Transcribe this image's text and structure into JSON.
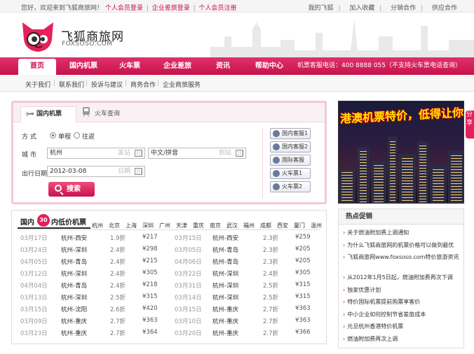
{
  "topbar": {
    "welcome": "您好，欢迎来到飞狐商旅网！",
    "member_login": "个人会员登录",
    "corp_login": "企业差旅登录",
    "register": "个人会员注册",
    "sep": "|",
    "right": [
      "我的飞狐",
      "加入收藏",
      "分销合作",
      "供应合作"
    ],
    "right_sep": "|"
  },
  "logo": {
    "name": "飞狐商旅网",
    "domain": "FOXSOSO.COM"
  },
  "nav": {
    "items": [
      "首页",
      "国内机票",
      "火车票",
      "企业差旅",
      "资讯",
      "帮助中心"
    ],
    "phone": "机票客服电话：400 8888 055（不支持火车票电话查询）"
  },
  "subnav": {
    "items": [
      "关于我们",
      "联系我们",
      "投诉与建议",
      "商务合作",
      "企业商旅服务"
    ],
    "sep": "|"
  },
  "search": {
    "tabs": [
      "国内机票",
      "火车查询"
    ],
    "trip_label": "方 式",
    "oneway": "单程",
    "roundtrip": "往返",
    "city_label": "城 市",
    "from_value": "杭州",
    "from_hint": "发站",
    "to_value": "中文/拼音",
    "to_hint": "到站",
    "date_label": "出行日期",
    "date_value": "2012-03-08",
    "date_hint": "日期",
    "search_btn": "搜索",
    "services": [
      "国内客服1",
      "国内客服2",
      "国际客服",
      "火车票1",
      "火车票2"
    ]
  },
  "lowfares": {
    "title_a": "国内",
    "badge": "30",
    "title_b": "内低价机票",
    "cities": [
      "杭州",
      "北京",
      "上海",
      "深圳",
      "广州",
      "天津",
      "重庆",
      "南京",
      "武汉",
      "福州",
      "成都",
      "西安",
      "厦门",
      "温州"
    ],
    "left": [
      {
        "date": "03月17日",
        "route": "杭州-西安",
        "discount": "1.9折",
        "price": "¥217"
      },
      {
        "date": "03月24日",
        "route": "杭州-深圳",
        "discount": "2.4折",
        "price": "¥298"
      },
      {
        "date": "04月05日",
        "route": "杭州-青岛",
        "discount": "2.4折",
        "price": "¥215"
      },
      {
        "date": "03月12日",
        "route": "杭州-深圳",
        "discount": "2.4折",
        "price": "¥305"
      },
      {
        "date": "04月04日",
        "route": "杭州-青岛",
        "discount": "2.4折",
        "price": "¥218"
      },
      {
        "date": "03月13日",
        "route": "杭州-深圳",
        "discount": "2.5折",
        "price": "¥315"
      },
      {
        "date": "03月15日",
        "route": "杭州-沈阳",
        "discount": "2.6折",
        "price": "¥420"
      },
      {
        "date": "03月09日",
        "route": "杭州-重庆",
        "discount": "2.7折",
        "price": "¥363"
      },
      {
        "date": "03月23日",
        "route": "杭州-重庆",
        "discount": "2.7折",
        "price": "¥364"
      }
    ],
    "right": [
      {
        "date": "03月15日",
        "route": "杭州-西安",
        "discount": "2.3折",
        "price": "¥259"
      },
      {
        "date": "03月05日",
        "route": "杭州-青岛",
        "discount": "2.3折",
        "price": "¥205"
      },
      {
        "date": "04月06日",
        "route": "杭州-青岛",
        "discount": "2.3折",
        "price": "¥205"
      },
      {
        "date": "03月22日",
        "route": "杭州-深圳",
        "discount": "2.4折",
        "price": "¥305"
      },
      {
        "date": "03月31日",
        "route": "杭州-深圳",
        "discount": "2.5折",
        "price": "¥315"
      },
      {
        "date": "03月14日",
        "route": "杭州-深圳",
        "discount": "2.5折",
        "price": "¥315"
      },
      {
        "date": "03月15日",
        "route": "杭州-重庆",
        "discount": "2.7折",
        "price": "¥363"
      },
      {
        "date": "03月10日",
        "route": "杭州-重庆",
        "discount": "2.7折",
        "price": "¥363"
      },
      {
        "date": "03月20日",
        "route": "杭州-重庆",
        "discount": "2.7折",
        "price": "¥366"
      }
    ]
  },
  "ad": {
    "headline": "港澳机票特价，低得让你心跳"
  },
  "side_tab": "分享",
  "hot": {
    "title": "热点促销",
    "bullet": "›",
    "items": [
      "关于燃油附加费上调通知",
      "为什么飞狐商旅网的机票价格可以做到最优",
      "飞狐商旅网www.foxsoso.com特价旅游资讯",
      "从2012年1月5日起，燃油附加费再次下调",
      "独家优惠计划",
      "特价国际机票提前购票享客价",
      "中小企业如何控制节省差旅成本",
      "元旦杭州香港特价机票",
      "燃油附加费再次上调"
    ]
  }
}
